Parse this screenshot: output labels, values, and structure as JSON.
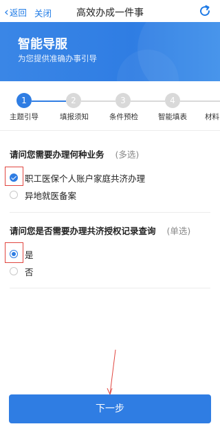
{
  "header": {
    "back_label": "返回",
    "close_label": "关闭",
    "title": "高效办成一件事"
  },
  "banner": {
    "title": "智能导服",
    "subtitle": "为您提供准确办事引导"
  },
  "steps": [
    {
      "num": "1",
      "label": "主题引导",
      "active": true
    },
    {
      "num": "2",
      "label": "填报须知",
      "active": false
    },
    {
      "num": "3",
      "label": "条件预检",
      "active": false
    },
    {
      "num": "4",
      "label": "智能填表",
      "active": false
    },
    {
      "num": "",
      "label": "材料",
      "active": false
    }
  ],
  "question1": {
    "text": "请问您需要办理何种业务",
    "hint": "(多选)",
    "options": [
      {
        "label": "职工医保个人账户家庭共济办理",
        "checked": true
      },
      {
        "label": "异地就医备案",
        "checked": false
      }
    ]
  },
  "question2": {
    "text": "请问您是否需要办理共济授权记录查询",
    "hint": "(单选)",
    "options": [
      {
        "label": "是",
        "checked": true
      },
      {
        "label": "否",
        "checked": false
      }
    ]
  },
  "footer": {
    "next_label": "下一步"
  },
  "colors": {
    "accent": "#2f7de3",
    "highlight": "#e0443e"
  }
}
